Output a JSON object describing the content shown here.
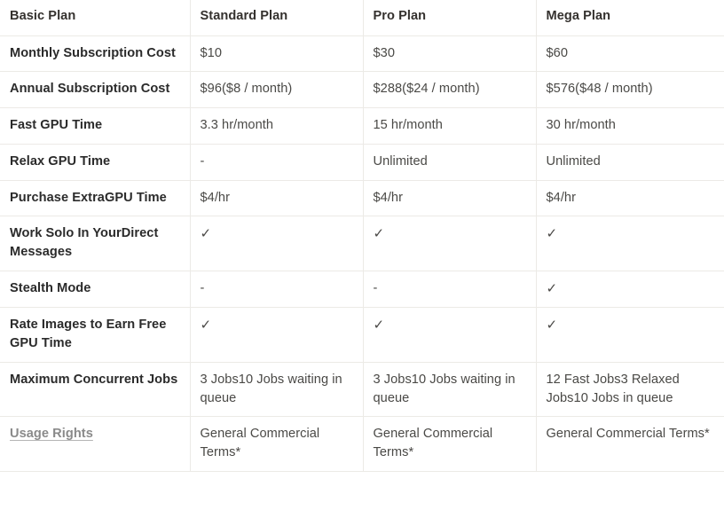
{
  "table": {
    "columns": [
      {
        "key": "feature",
        "label": "Basic Plan"
      },
      {
        "key": "standard",
        "label": "Standard Plan"
      },
      {
        "key": "pro",
        "label": "Pro Plan"
      },
      {
        "key": "mega",
        "label": "Mega Plan"
      }
    ],
    "rows": [
      {
        "feature": "Monthly Subscription Cost",
        "standard": "$10",
        "pro": "$30",
        "mega": "$60"
      },
      {
        "feature": "Annual Subscription Cost",
        "standard": "$96($8 / month)",
        "pro": "$288($24 / month)",
        "mega": "$576($48 / month)"
      },
      {
        "feature": "Fast GPU Time",
        "standard": "3.3 hr/month",
        "pro": "15 hr/month",
        "mega": "30 hr/month"
      },
      {
        "feature": "Relax GPU Time",
        "standard": "-",
        "pro": "Unlimited",
        "mega": "Unlimited"
      },
      {
        "feature": "Purchase ExtraGPU Time",
        "standard": "$4/hr",
        "pro": "$4/hr",
        "mega": "$4/hr"
      },
      {
        "feature": "Work Solo In YourDirect Messages",
        "standard": "✓",
        "pro": "✓",
        "mega": "✓"
      },
      {
        "feature": "Stealth Mode",
        "standard": "-",
        "pro": "-",
        "mega": "✓"
      },
      {
        "feature": "Rate Images to Earn Free GPU Time",
        "standard": "✓",
        "pro": "✓",
        "mega": "✓"
      },
      {
        "feature": "Maximum Concurrent Jobs",
        "standard": "3 Jobs10 Jobs waiting in queue",
        "pro": "3 Jobs10 Jobs waiting in queue",
        "mega": "12 Fast Jobs3 Relaxed Jobs10 Jobs in queue"
      },
      {
        "feature": "Usage Rights",
        "feature_is_link": true,
        "standard": "General Commercial Terms*",
        "pro": "General Commercial Terms*",
        "mega": "General Commercial Terms*"
      }
    ]
  },
  "colors": {
    "border": "#eceae6",
    "text_strong": "#2b2b2b",
    "text_value": "#4a4946",
    "link": "#8a8a8a",
    "background": "#ffffff"
  }
}
